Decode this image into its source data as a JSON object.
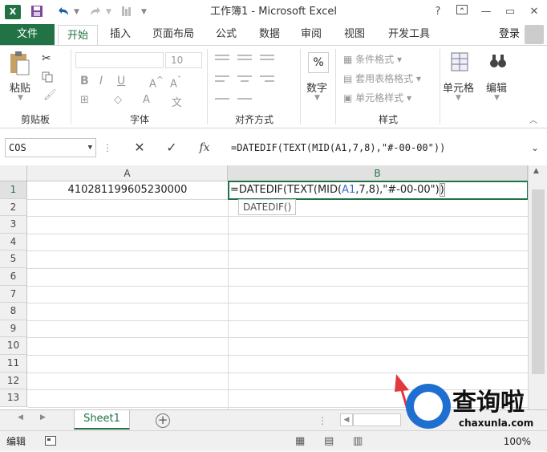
{
  "window": {
    "title": "工作簿1 - Microsoft Excel",
    "help": "?",
    "minimize": "—",
    "restore": "▭",
    "close": "✕"
  },
  "quick_access": {
    "logo": "X",
    "save_icon": "save-icon",
    "undo_icon": "undo-icon",
    "redo_icon": "redo-icon"
  },
  "tabs": [
    "文件",
    "开始",
    "插入",
    "页面布局",
    "公式",
    "数据",
    "审阅",
    "视图",
    "开发工具"
  ],
  "login_label": "登录",
  "ribbon": {
    "clipboard": {
      "paste_label": "粘贴",
      "group_label": "剪贴板"
    },
    "font": {
      "size_value": "10",
      "group_label": "字体",
      "bold": "B",
      "italic": "I",
      "underline": "U"
    },
    "alignment": {
      "group_label": "对齐方式"
    },
    "number": {
      "label": "数字",
      "symbol": "%"
    },
    "styles": {
      "conditional": "条件格式",
      "table_format": "套用表格格式",
      "cell_styles": "单元格样式",
      "group_label": "样式"
    },
    "cells": {
      "label": "单元格"
    },
    "editing": {
      "label": "编辑"
    }
  },
  "formula_bar": {
    "namebox_value": "COS",
    "cancel": "✕",
    "confirm": "✓",
    "fx": "fx",
    "formula_value": "=DATEDIF(TEXT(MID(A1,7,8),\"#-00-00\"))"
  },
  "grid": {
    "columns": [
      "A",
      "B"
    ],
    "rows": [
      "1",
      "2",
      "3",
      "4",
      "5",
      "6",
      "7",
      "8",
      "9",
      "10",
      "11",
      "12",
      "13"
    ],
    "a1_value": "410281199605230000",
    "b1_parts": [
      "=DATEDIF(TEXT(MID(",
      "A1",
      ",7,8),\"#-00-00\")",
      ")"
    ],
    "tooltip": "DATEDIF()"
  },
  "sheet_tabs": [
    "Sheet1"
  ],
  "add_sheet": "+",
  "status": {
    "mode": "编辑",
    "zoom": "100%"
  },
  "watermark": {
    "brand": "查询啦",
    "url": "chaxunla.com"
  },
  "colors": {
    "accent": "#217346",
    "arrow": "#e0393e",
    "reference": "#3b6ec8"
  }
}
